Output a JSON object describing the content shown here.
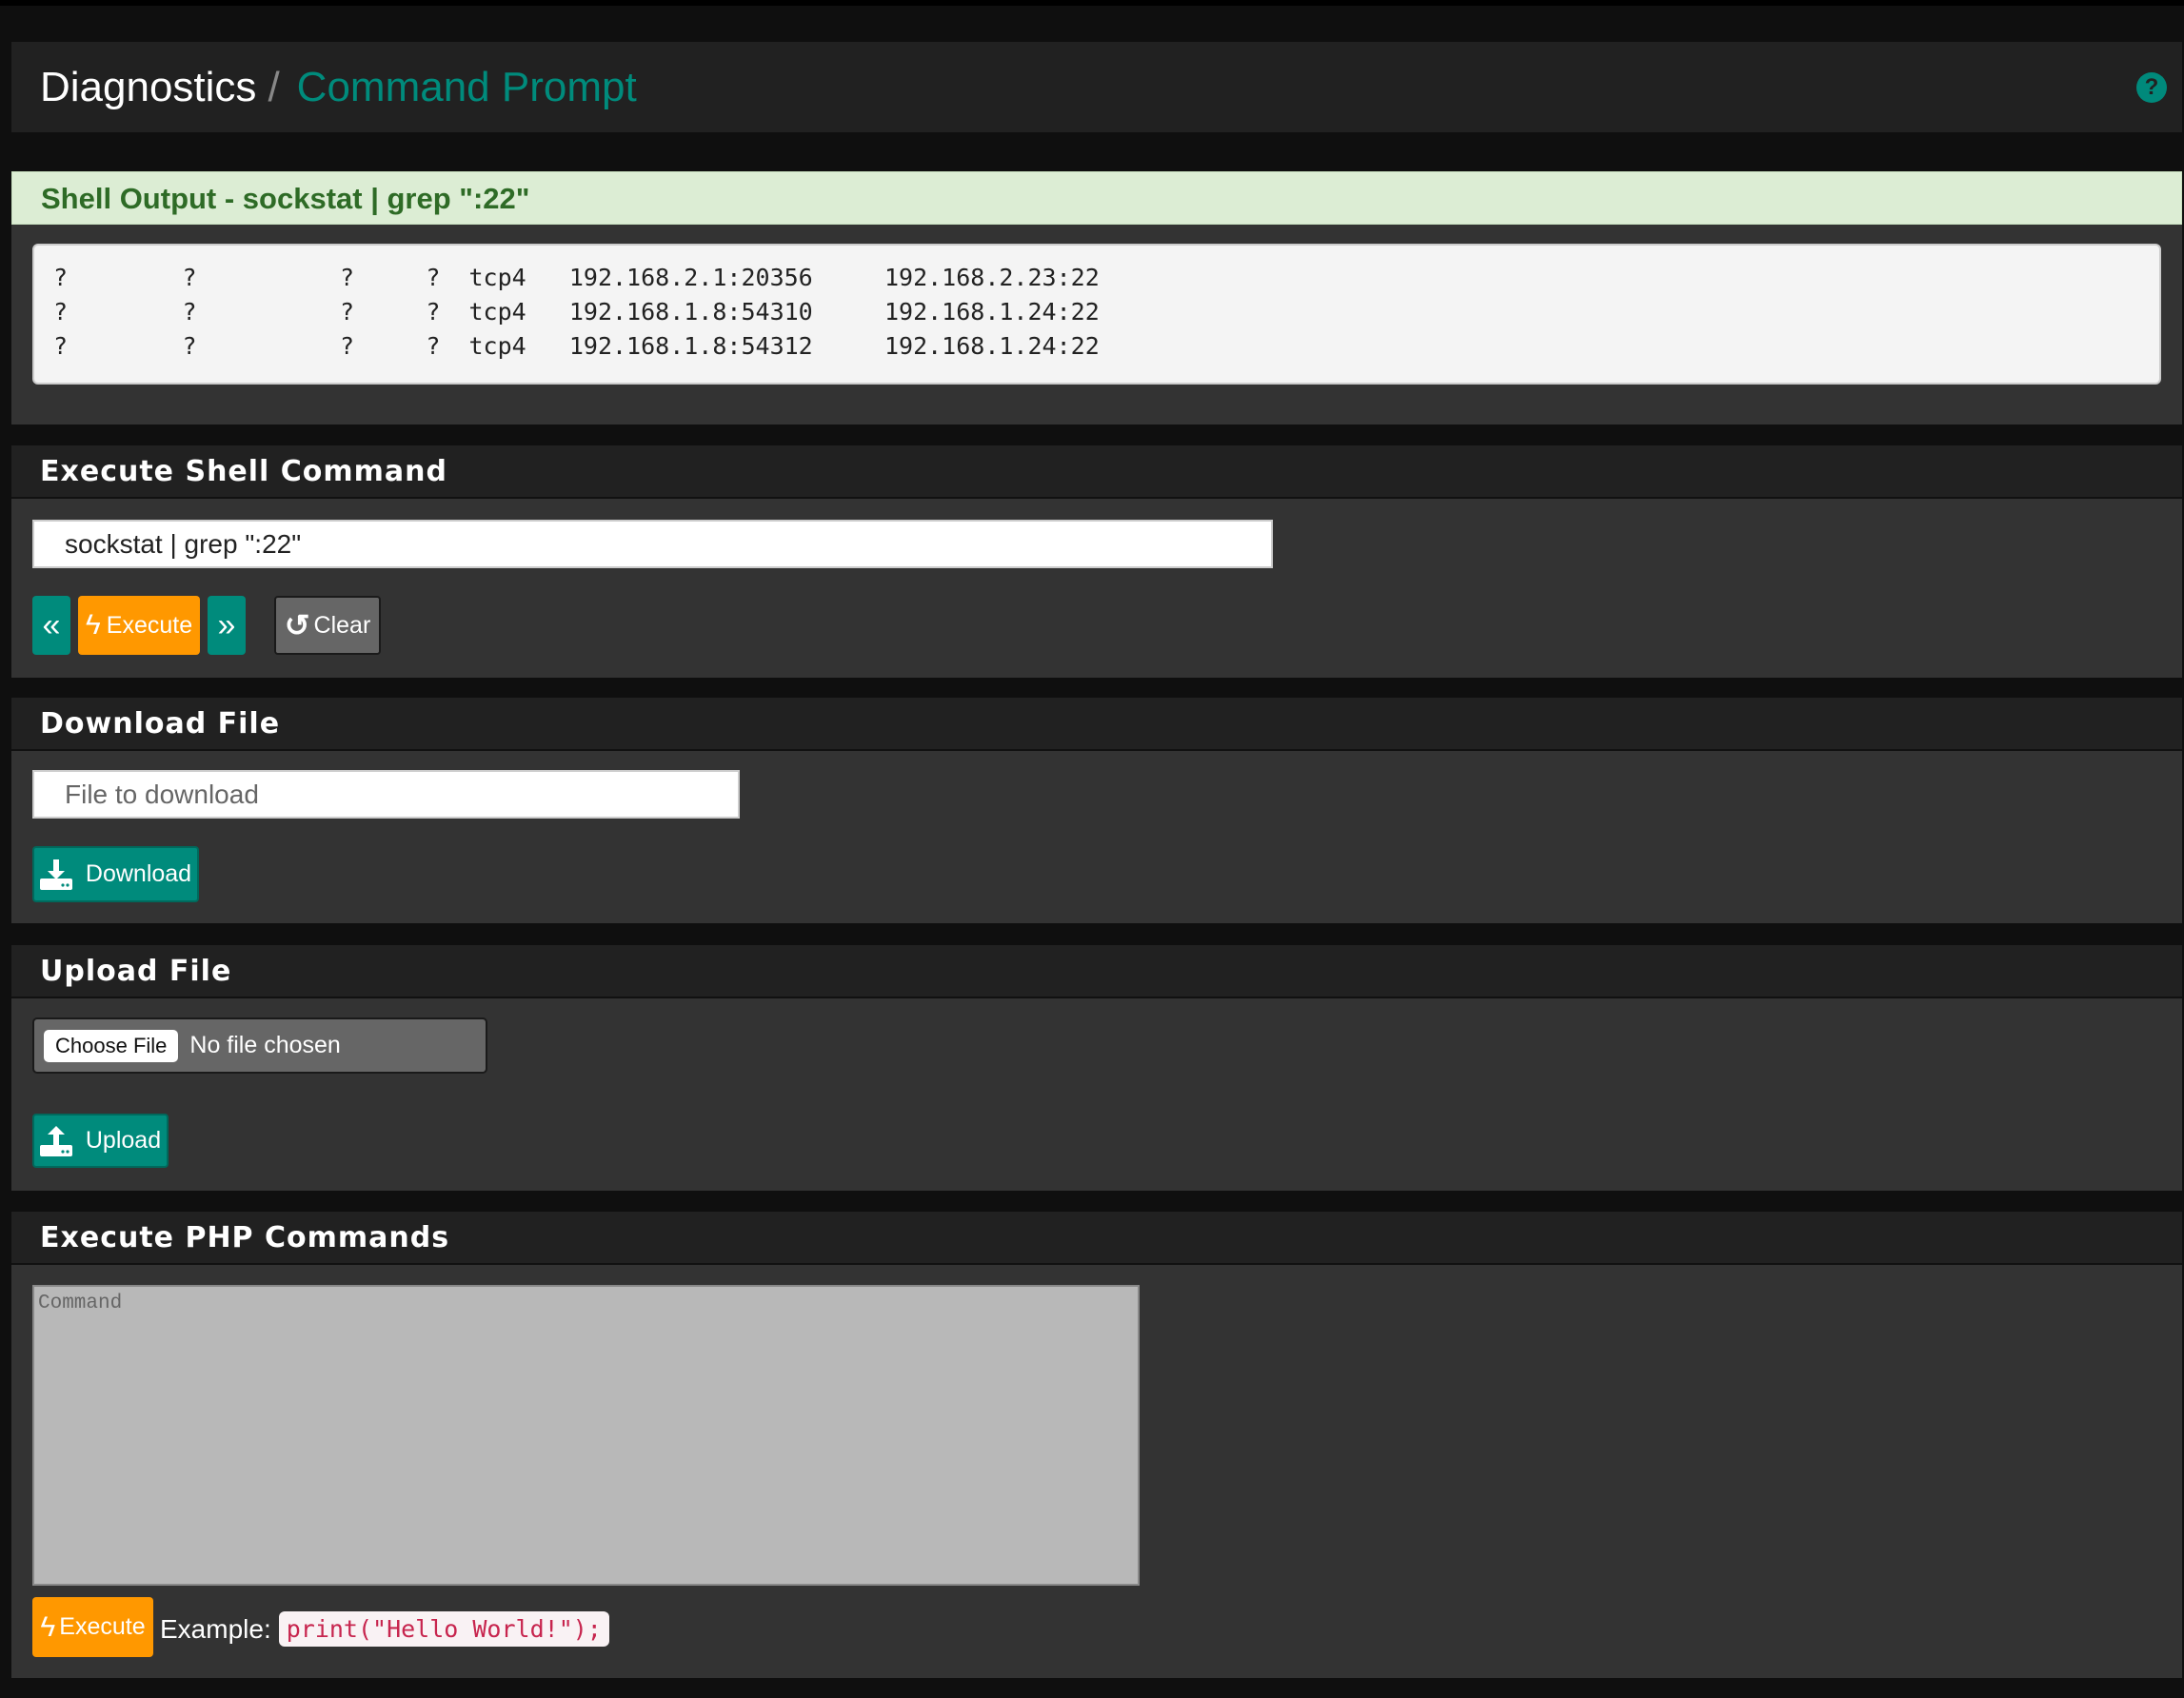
{
  "header": {
    "breadcrumb_parent": "Diagnostics",
    "separator": "/",
    "title": "Command Prompt",
    "help_icon": "question-circle-icon"
  },
  "shell_output": {
    "title": "Shell Output - sockstat | grep \":22\"",
    "lines": [
      "?        ?          ?     ?  tcp4   192.168.2.1:20356     192.168.2.23:22",
      "?        ?          ?     ?  tcp4   192.168.1.8:54310     192.168.1.24:22",
      "?        ?          ?     ?  tcp4   192.168.1.8:54312     192.168.1.24:22"
    ]
  },
  "execute_shell": {
    "title": "Execute Shell Command",
    "command_value": "sockstat | grep \":22\"",
    "prev_label": "«",
    "execute_label": "Execute",
    "next_label": "»",
    "clear_label": "Clear"
  },
  "download": {
    "title": "Download File",
    "placeholder": "File to download",
    "button_label": "Download"
  },
  "upload": {
    "title": "Upload File",
    "choose_label": "Choose File",
    "no_file": "No file chosen",
    "button_label": "Upload"
  },
  "php": {
    "title": "Execute PHP Commands",
    "placeholder": "Command",
    "execute_label": "Execute",
    "example_label": "Example:",
    "example_code": "print(\"Hello World!\");"
  },
  "colors": {
    "accent": "#008b7c",
    "warning": "#ff9800",
    "success_bg": "#dcedd4"
  }
}
